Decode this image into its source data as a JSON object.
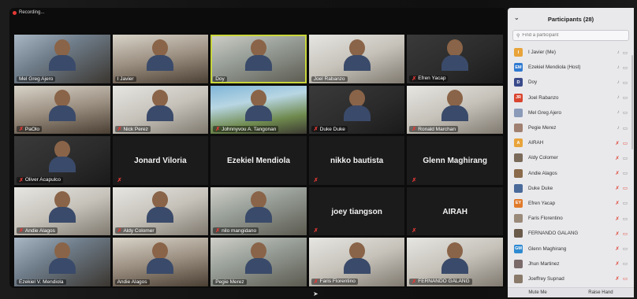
{
  "recording": {
    "label": "Recording..."
  },
  "tiles": [
    {
      "name": "Mel Greg Ajero",
      "muted": false,
      "style": "v1",
      "video": true
    },
    {
      "name": "I Javier",
      "muted": false,
      "style": "v2",
      "video": true
    },
    {
      "name": "Doy",
      "muted": false,
      "style": "v3",
      "video": true,
      "active": true
    },
    {
      "name": "Joel Rabanzo",
      "muted": false,
      "style": "v6",
      "video": true
    },
    {
      "name": "Efren Yacap",
      "muted": true,
      "style": "v5",
      "video": true
    },
    {
      "name": "PaOlo",
      "muted": true,
      "style": "v2",
      "video": true
    },
    {
      "name": "Nick Perez",
      "muted": true,
      "style": "v6",
      "video": true
    },
    {
      "name": "Johnnyvou A. Tangonan",
      "muted": true,
      "style": "v4",
      "video": true
    },
    {
      "name": "Duke Duke",
      "muted": true,
      "style": "v5",
      "video": true
    },
    {
      "name": "Ronald Marchan",
      "muted": true,
      "style": "v6",
      "video": true
    },
    {
      "name": "Oliver Acapulco",
      "muted": true,
      "style": "v5",
      "video": true
    },
    {
      "name": "Jonard Viloria",
      "muted": false,
      "video": false,
      "mutedIcon": true
    },
    {
      "name": "Ezekiel Mendiola",
      "muted": false,
      "video": false,
      "mutedIcon": false
    },
    {
      "name": "nikko bautista",
      "muted": false,
      "video": false,
      "mutedIcon": true
    },
    {
      "name": "Glenn Maghirang",
      "muted": false,
      "video": false,
      "mutedIcon": true
    },
    {
      "name": "Andie Alagos",
      "muted": true,
      "style": "v6",
      "video": true
    },
    {
      "name": "Aldy Colomer",
      "muted": true,
      "style": "v6",
      "video": true
    },
    {
      "name": "nilo mangidano",
      "muted": true,
      "style": "v3",
      "video": true
    },
    {
      "name": "joey tiangson",
      "muted": false,
      "video": false,
      "mutedIcon": true
    },
    {
      "name": "AIRAH",
      "muted": false,
      "video": false,
      "mutedIcon": true
    },
    {
      "name": "Ezekiel V. Mendiola",
      "muted": false,
      "style": "v1",
      "video": true
    },
    {
      "name": "Andie Alagos",
      "muted": false,
      "style": "v2",
      "video": true
    },
    {
      "name": "Pegie Merez",
      "muted": false,
      "style": "v3",
      "video": true
    },
    {
      "name": "Faris Florentino",
      "muted": true,
      "style": "v6",
      "video": true
    },
    {
      "name": "FERNANDO GALANG",
      "muted": true,
      "style": "v6",
      "video": true
    }
  ],
  "participants": {
    "title": "Participants (28)",
    "search_placeholder": "Find a participant",
    "items": [
      {
        "name": "I Javier (Me)",
        "initials": "I",
        "color": "#e8a33a",
        "mic": "on"
      },
      {
        "name": "Ezekiel Mendiola (Host)",
        "initials": "EM",
        "color": "#2f7ad1",
        "mic": "on"
      },
      {
        "name": "Doy",
        "initials": "D",
        "color": "#3a4a8a",
        "mic": "on"
      },
      {
        "name": "Joel Rabanzo",
        "initials": "JR",
        "color": "#d9452f",
        "mic": "on"
      },
      {
        "name": "Mel Greg Ajero",
        "initials": "",
        "color": "#8a9ab8",
        "mic": "on"
      },
      {
        "name": "Pegie Merez",
        "initials": "",
        "color": "#a08070",
        "mic": "on"
      },
      {
        "name": "AIRAH",
        "initials": "A",
        "color": "#e8a33a",
        "mic": "off"
      },
      {
        "name": "Aldy Colomer",
        "initials": "",
        "color": "#7a6a5a",
        "mic": "off"
      },
      {
        "name": "Andie Alagos",
        "initials": "",
        "color": "#8a6a4a",
        "mic": "off"
      },
      {
        "name": "Duke Duke",
        "initials": "",
        "color": "#4a6a9a",
        "mic": "off"
      },
      {
        "name": "Efren Yacap",
        "initials": "EY",
        "color": "#e07a2a",
        "mic": "off"
      },
      {
        "name": "Faris Florentino",
        "initials": "",
        "color": "#9a8a7a",
        "mic": "off"
      },
      {
        "name": "FERNANDO GALANG",
        "initials": "",
        "color": "#6a5a4a",
        "mic": "off"
      },
      {
        "name": "Glenn Maghirang",
        "initials": "GM",
        "color": "#2f8ad1",
        "mic": "off"
      },
      {
        "name": "Jhun Martinez",
        "initials": "",
        "color": "#7a6a6a",
        "mic": "off"
      },
      {
        "name": "Joeffrey Supnad",
        "initials": "",
        "color": "#8a7a6a",
        "mic": "off"
      }
    ],
    "footer": {
      "mute_me": "Mute Me",
      "raise_hand": "Raise Hand"
    }
  }
}
